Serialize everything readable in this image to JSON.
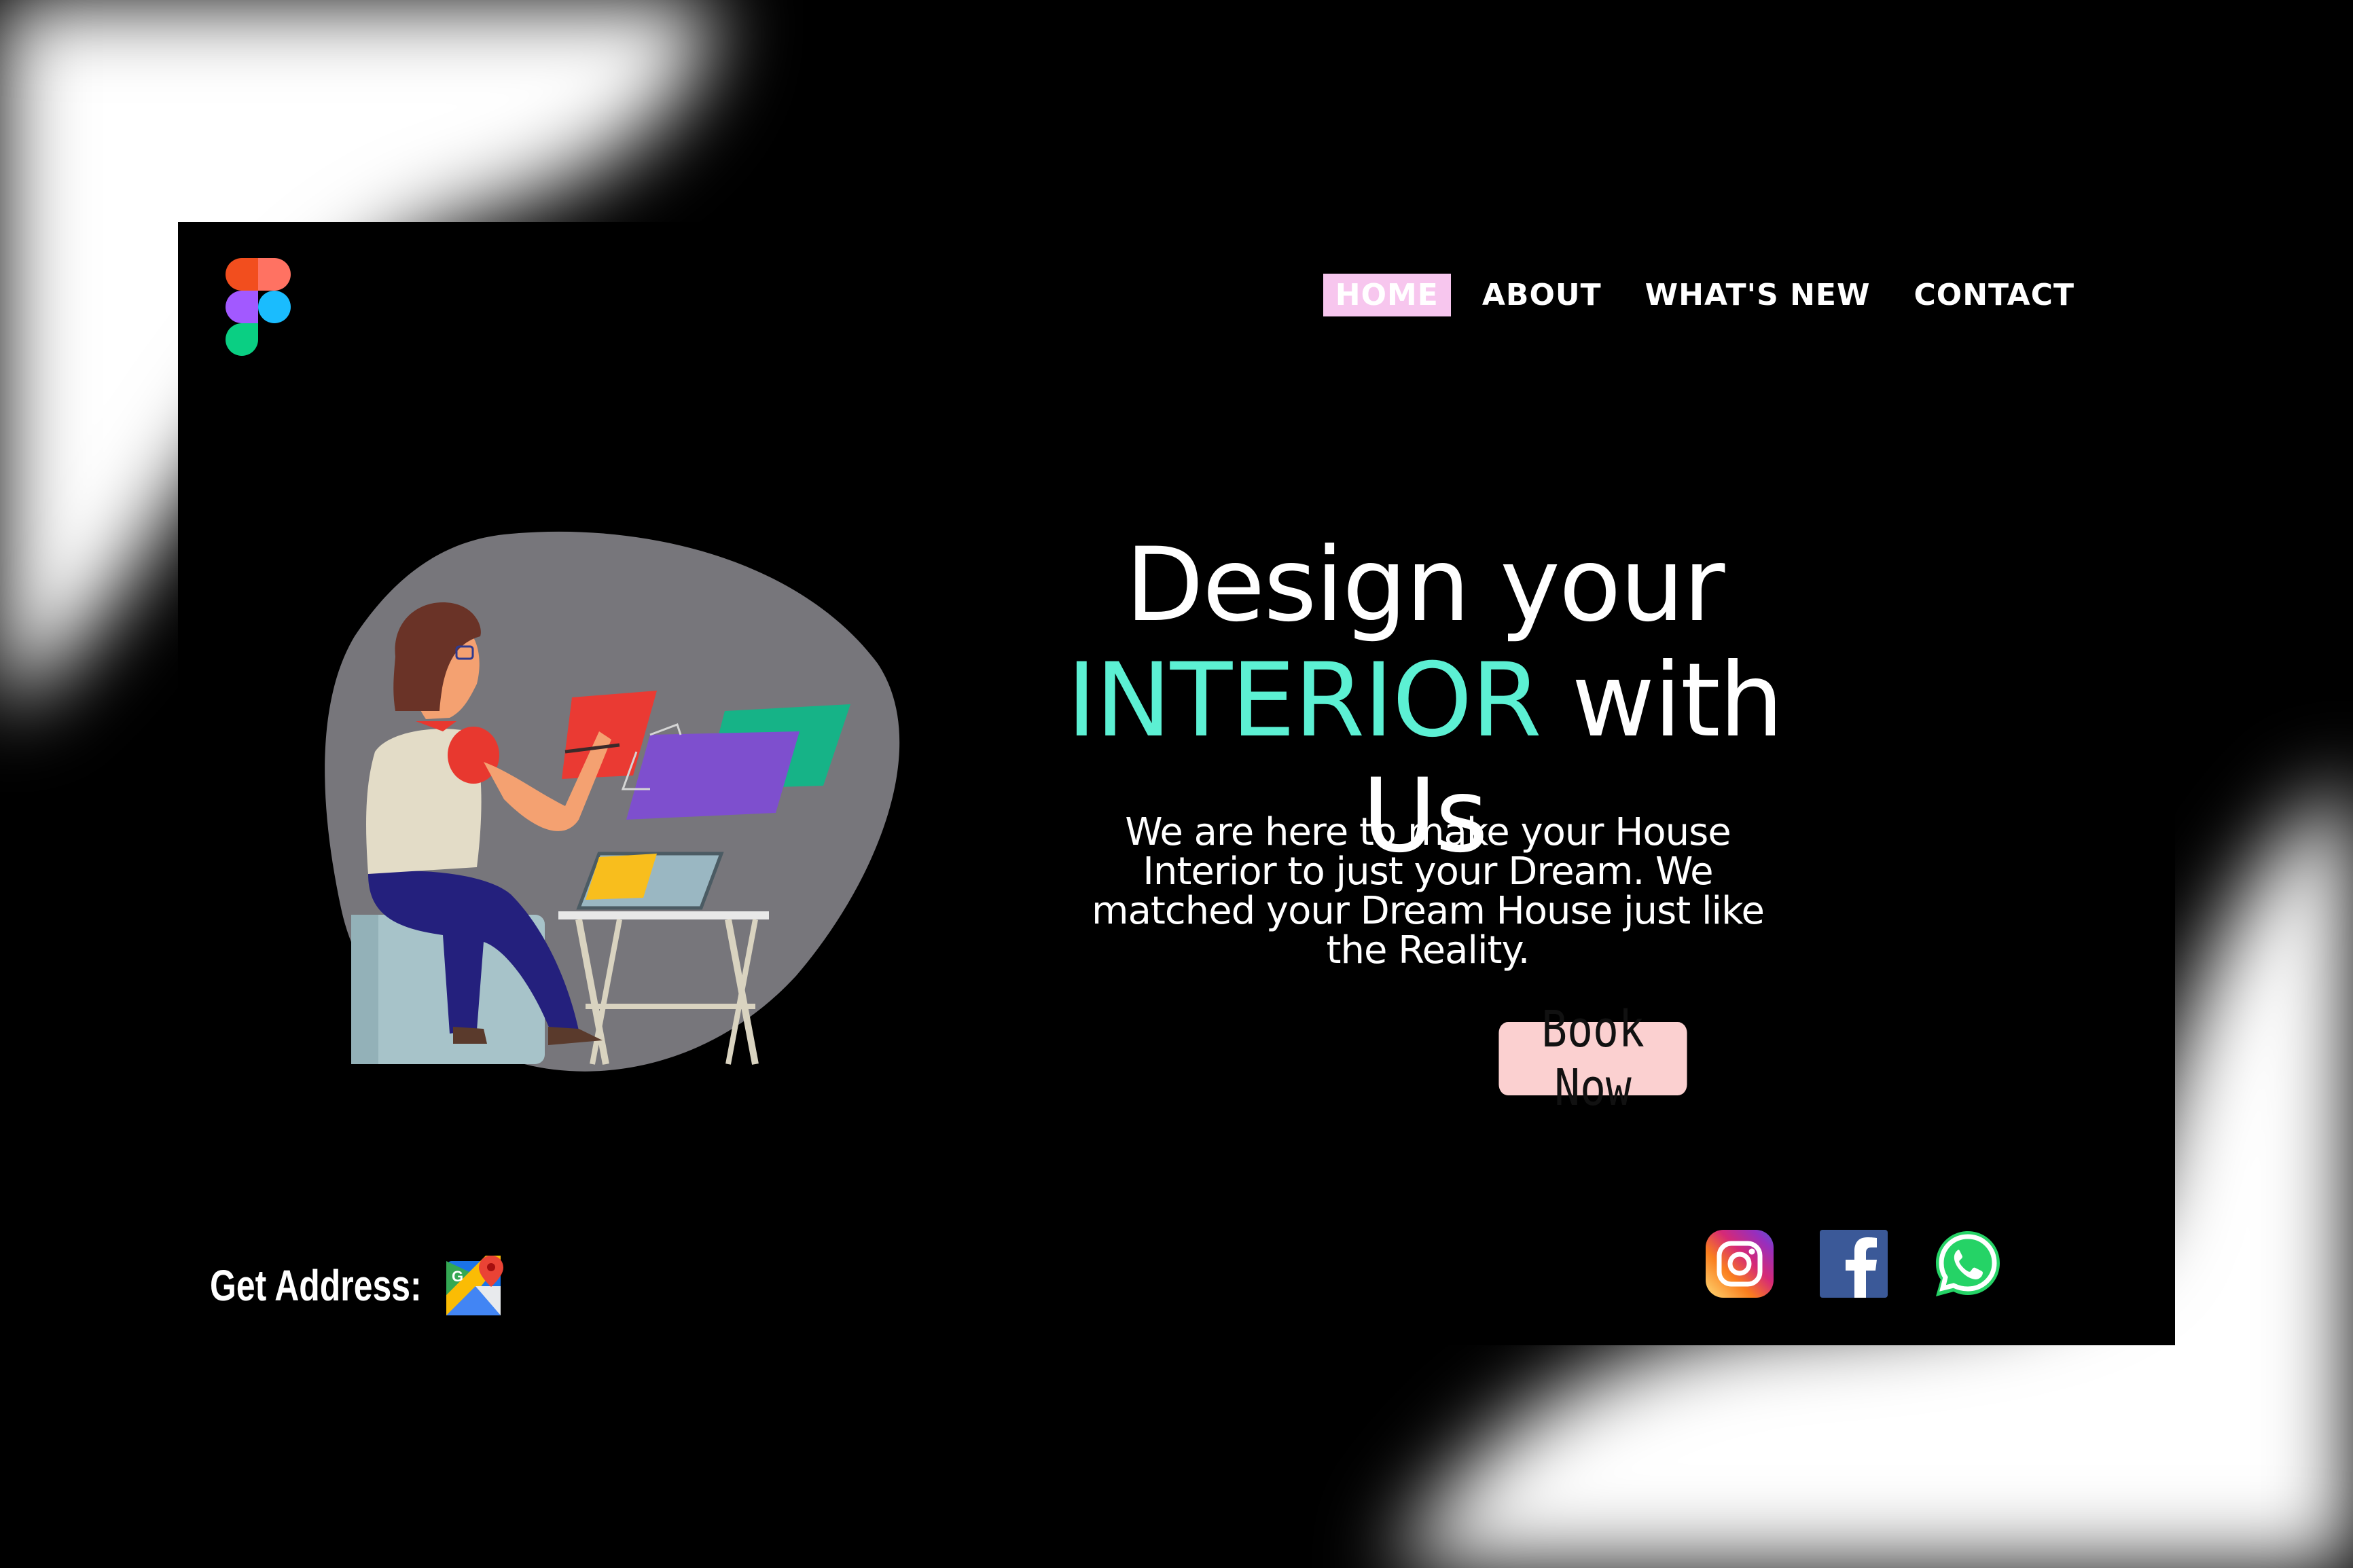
{
  "nav": {
    "items": [
      {
        "label": "HOME",
        "active": true
      },
      {
        "label": "ABOUT",
        "active": false
      },
      {
        "label": "WHAT'S NEW",
        "active": false
      },
      {
        "label": "CONTACT",
        "active": false
      }
    ]
  },
  "hero": {
    "line1": "Design your",
    "accent_word": "INTERIOR",
    "line2_rest": " with Us",
    "description": "We are here to make your House Interior to just your Dream. We matched your Dream House just like the Reality.",
    "cta_label": "Book Now"
  },
  "footer": {
    "address_label": "Get Address:",
    "address_icon": "google-maps-icon",
    "social_icons": [
      "instagram-icon",
      "facebook-icon",
      "whatsapp-icon"
    ]
  },
  "colors": {
    "background": "#000000",
    "accent": "#5cf0d3",
    "nav_active_bg": "#f7c6ee",
    "button_bg": "#fbd0d0"
  },
  "logo": "figma-logo-icon"
}
